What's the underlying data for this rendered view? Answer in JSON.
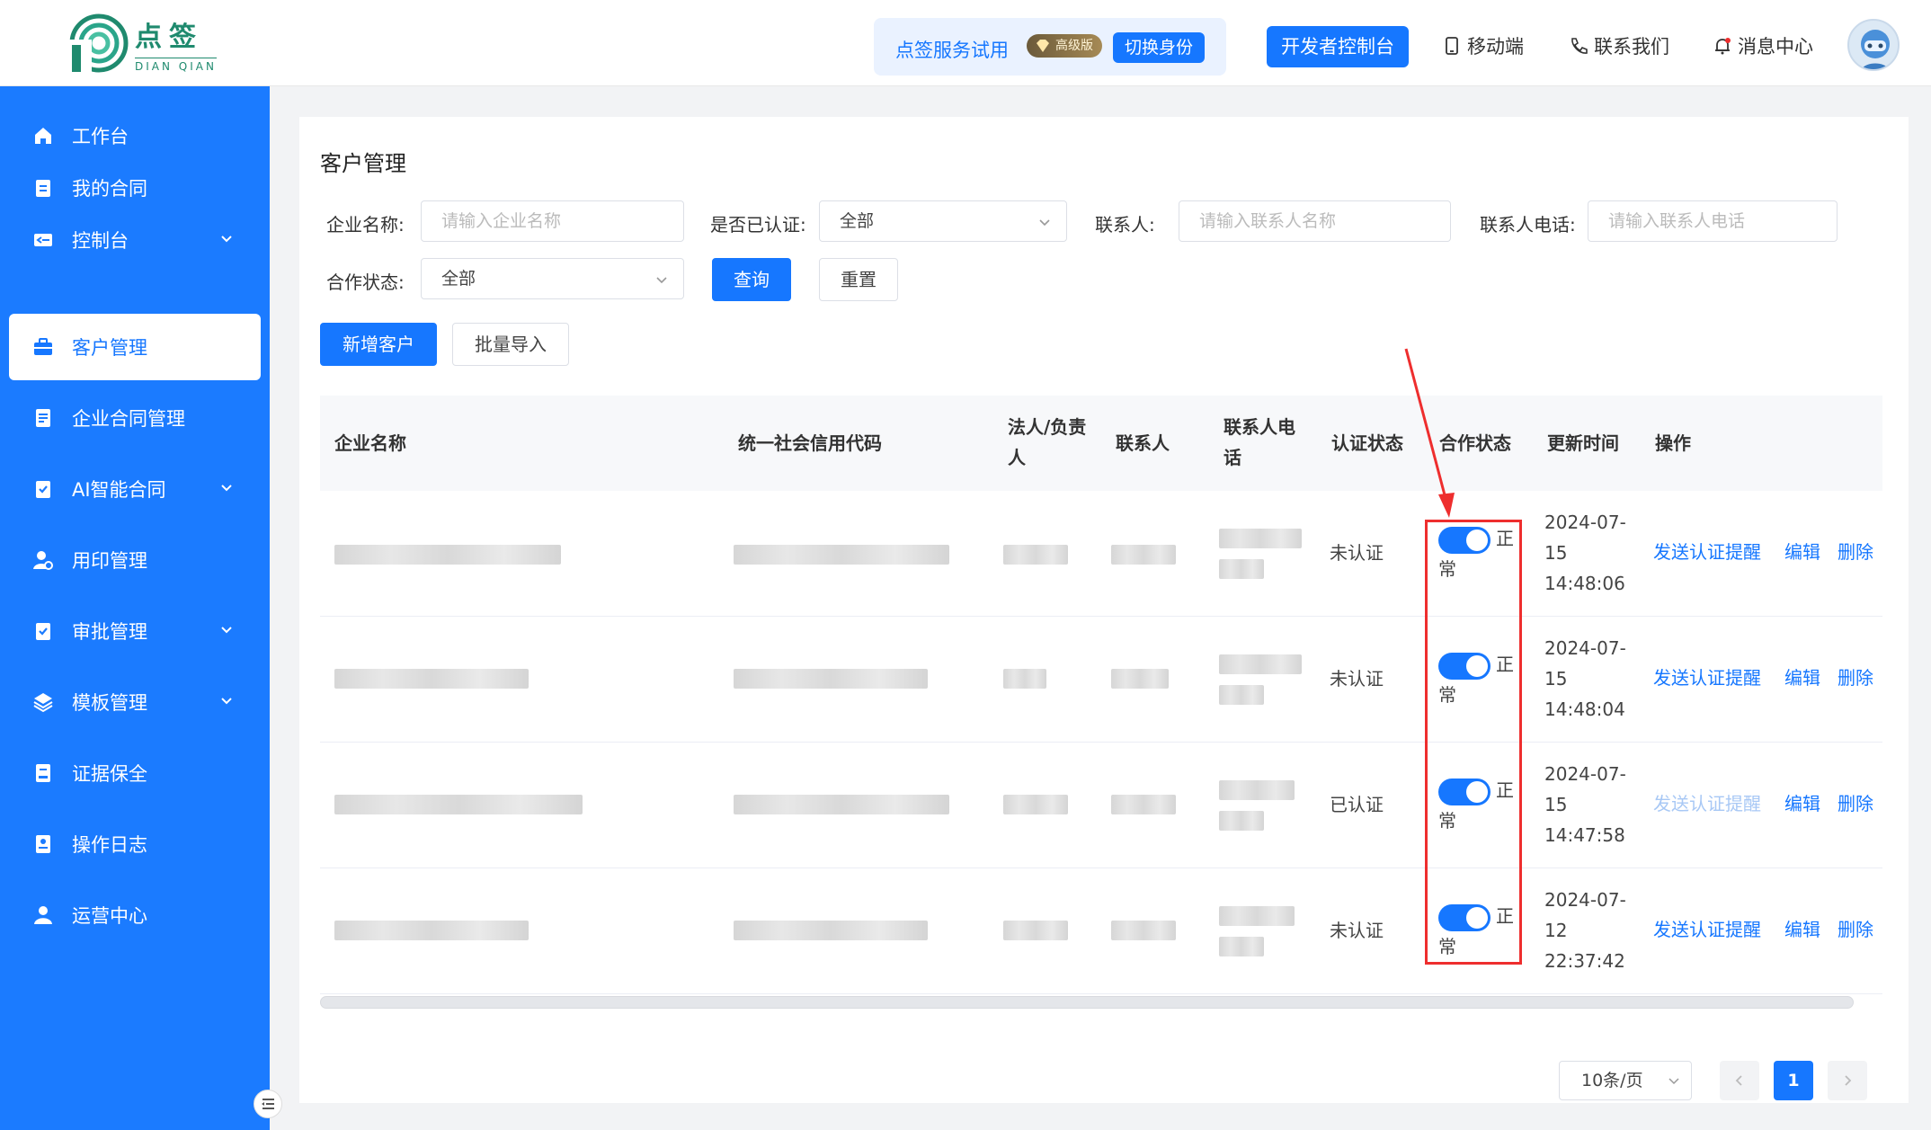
{
  "header": {
    "logo_cn": "点签",
    "logo_en": "DIAN QIAN",
    "trial_text": "点签服务试用",
    "vip_badge": "高级版",
    "switch_identity": "切换身份",
    "dev_console": "开发者控制台",
    "mobile": "移动端",
    "contact": "联系我们",
    "messages": "消息中心"
  },
  "sidebar": {
    "items": [
      {
        "label": "工作台",
        "icon": "home-icon"
      },
      {
        "label": "我的合同",
        "icon": "clipboard-icon"
      },
      {
        "label": "控制台",
        "icon": "console-icon"
      },
      {
        "label": "客户管理",
        "icon": "briefcase-icon"
      },
      {
        "label": "企业合同管理",
        "icon": "document-icon"
      },
      {
        "label": "AI智能合同",
        "icon": "clipboard-check-icon"
      },
      {
        "label": "用印管理",
        "icon": "user-seal-icon"
      },
      {
        "label": "审批管理",
        "icon": "clipboard-check-icon"
      },
      {
        "label": "模板管理",
        "icon": "layers-icon"
      },
      {
        "label": "证据保全",
        "icon": "evidence-icon"
      },
      {
        "label": "操作日志",
        "icon": "log-icon"
      },
      {
        "label": "运营中心",
        "icon": "user-icon"
      }
    ],
    "active_index": 3
  },
  "page": {
    "title": "客户管理",
    "filters": {
      "company_label": "企业名称:",
      "company_placeholder": "请输入企业名称",
      "verified_label": "是否已认证:",
      "verified_value": "全部",
      "contact_label": "联系人:",
      "contact_placeholder": "请输入联系人名称",
      "phone_label": "联系人电话:",
      "phone_placeholder": "请输入联系人电话",
      "coop_label": "合作状态:",
      "coop_value": "全部",
      "search": "查询",
      "reset": "重置"
    },
    "actions": {
      "add": "新增客户",
      "import": "批量导入"
    },
    "table": {
      "columns": [
        "企业名称",
        "统一社会信用代码",
        "法人/负责人",
        "联系人",
        "联系人电话",
        "认证状态",
        "合作状态",
        "更新时间",
        "操作"
      ],
      "rows": [
        {
          "auth": "未认证",
          "coop": "正常",
          "time": "2024-07-15 14:48:06",
          "remind_enabled": true
        },
        {
          "auth": "未认证",
          "coop": "正常",
          "time": "2024-07-15 14:48:04",
          "remind_enabled": true
        },
        {
          "auth": "已认证",
          "coop": "正常",
          "time": "2024-07-15 14:47:58",
          "remind_enabled": false
        },
        {
          "auth": "未认证",
          "coop": "正常",
          "time": "2024-07-12 22:37:42",
          "remind_enabled": true
        }
      ],
      "op_remind": "发送认证提醒",
      "op_edit": "编辑",
      "op_delete": "删除"
    },
    "pagination": {
      "page_size": "10条/页",
      "current": "1"
    }
  },
  "colors": {
    "primary": "#1677ff",
    "sidebar": "#1b7bff",
    "annotation": "#ee2e2e"
  }
}
